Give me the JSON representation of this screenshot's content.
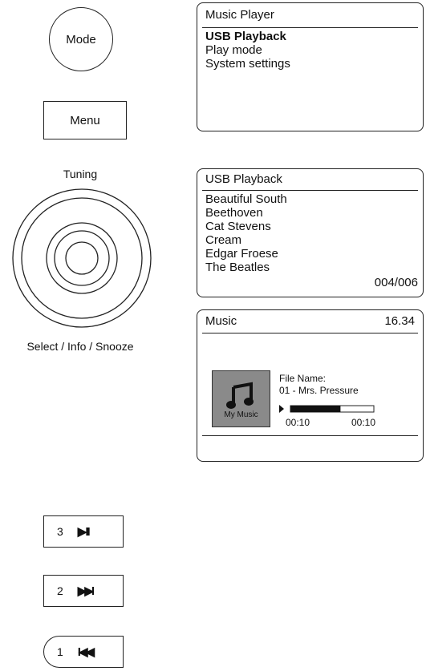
{
  "controls": {
    "mode_label": "Mode",
    "menu_label": "Menu",
    "knob_top_label": "Tuning",
    "knob_bottom_label": "Select / Info / Snooze"
  },
  "screen1": {
    "title": "Music Player",
    "items": [
      "USB Playback",
      "Play mode",
      "System settings"
    ],
    "selected_index": 0
  },
  "screen2": {
    "title": "USB Playback",
    "items": [
      "Beautiful South",
      "Beethoven",
      "Cat Stevens",
      "Cream",
      "Edgar Froese",
      "The Beatles"
    ],
    "counter": "004/006"
  },
  "screen3": {
    "title": "Music",
    "time": "16.34",
    "album_label": "My Music",
    "file_name_label": "File Name:",
    "file_name": "01 - Mrs. Pressure",
    "progress": 0.6,
    "elapsed": "00:10",
    "total": "00:10"
  },
  "keys": [
    {
      "number": "3",
      "icon": "play-pause-icon",
      "glyph": "▶II"
    },
    {
      "number": "2",
      "icon": "next-track-icon",
      "glyph": "▶▶I"
    },
    {
      "number": "1",
      "icon": "previous-track-icon",
      "glyph": "I◀◀"
    }
  ]
}
